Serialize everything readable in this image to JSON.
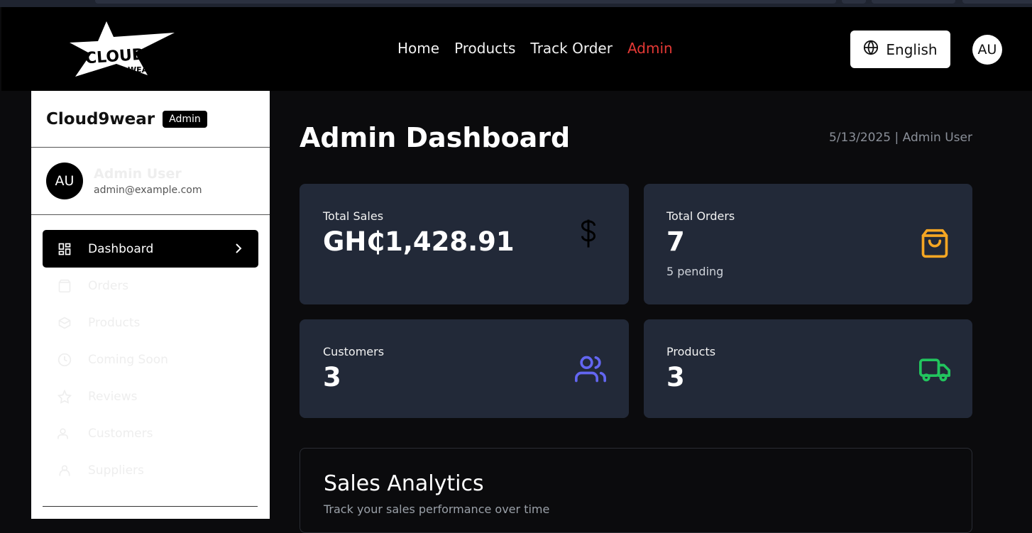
{
  "nav": {
    "links": [
      "Home",
      "Products",
      "Track Order",
      "Admin"
    ],
    "active_link": "Admin",
    "language": "English",
    "avatar_initials": "AU"
  },
  "sidebar": {
    "brand": "Cloud9wear",
    "badge": "Admin",
    "user": {
      "initials": "AU",
      "name": "Admin User",
      "email": "admin@example.com"
    },
    "items": [
      {
        "label": "Dashboard",
        "icon": "grid-icon",
        "active": true
      },
      {
        "label": "Orders",
        "icon": "bag-icon"
      },
      {
        "label": "Products",
        "icon": "box-icon"
      },
      {
        "label": "Coming Soon",
        "icon": "clock-icon"
      },
      {
        "label": "Reviews",
        "icon": "star-icon"
      },
      {
        "label": "Customers",
        "icon": "users-icon"
      },
      {
        "label": "Suppliers",
        "icon": "supplier-icon"
      }
    ]
  },
  "main": {
    "title": "Admin Dashboard",
    "meta": "5/13/2025 | Admin User",
    "cards": {
      "sales": {
        "label": "Total Sales",
        "value": "GH₵1,428.91",
        "icon": "dollar-icon"
      },
      "orders": {
        "label": "Total Orders",
        "value": "7",
        "sub": "5 pending",
        "icon": "shopping-bag-icon",
        "color": "#f5a623"
      },
      "customers": {
        "label": "Customers",
        "value": "3",
        "icon": "users-icon",
        "color": "#6366f1"
      },
      "products": {
        "label": "Products",
        "value": "3",
        "icon": "truck-icon",
        "color": "#22c55e"
      }
    },
    "analytics": {
      "title": "Sales Analytics",
      "subtitle": "Track your sales performance over time"
    }
  }
}
